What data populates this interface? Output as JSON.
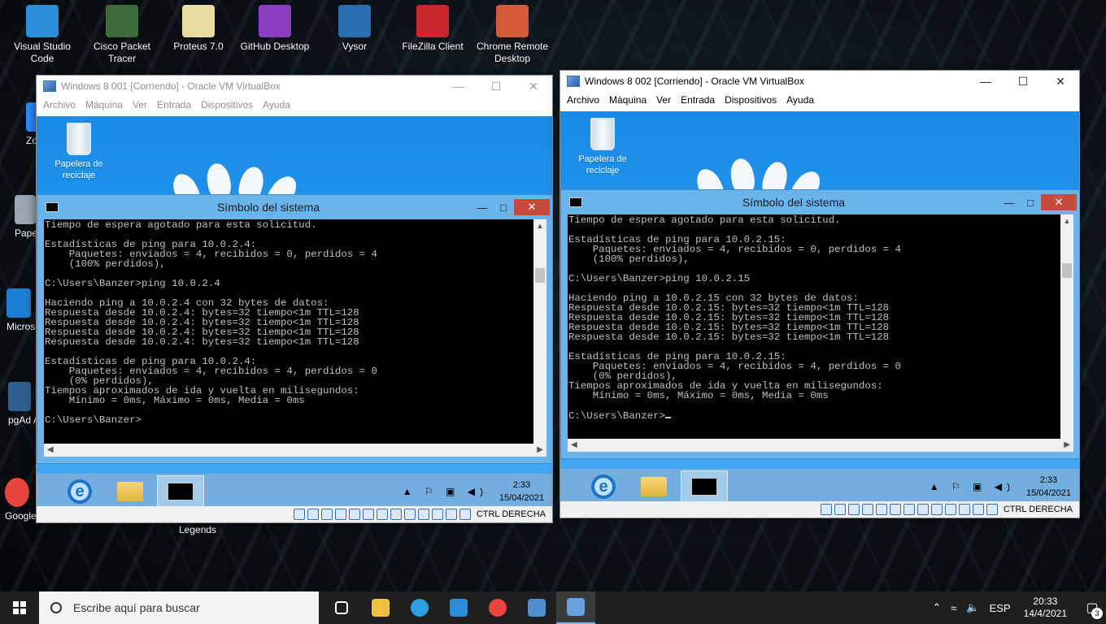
{
  "desktop": {
    "icons": [
      {
        "label": "Visual Studio Code",
        "icon": "vscode-icon",
        "color": "#2a8fd8"
      },
      {
        "label": "Cisco Packet Tracer",
        "icon": "cisco-icon",
        "color": "#3d6b3a"
      },
      {
        "label": "Proteus 7.0",
        "icon": "proteus-icon",
        "color": "#e8dca0"
      },
      {
        "label": "GitHub Desktop",
        "icon": "github-icon",
        "color": "#8a3fc0"
      },
      {
        "label": "Vysor",
        "icon": "vysor-icon",
        "color": "#2a6fb0"
      },
      {
        "label": "FileZilla Client",
        "icon": "filezilla-icon",
        "color": "#c8262c"
      },
      {
        "label": "Chrome Remote Desktop",
        "icon": "chrome-remote-icon",
        "color": "#d45a3a"
      }
    ],
    "left_clipped": [
      "Zo",
      "Pape rec",
      "Micros",
      "pgAd Acceso",
      "Google"
    ],
    "legends_label": "Legends"
  },
  "vm1": {
    "title": "Windows 8 001 [Corriendo] - Oracle VM VirtualBox",
    "menu": [
      "Archivo",
      "Máquina",
      "Ver",
      "Entrada",
      "Dispositivos",
      "Ayuda"
    ],
    "recycle_label": "Papelera de reciclaje",
    "cmd_title": "Símbolo del sistema",
    "cmd_lines": [
      "Tiempo de espera agotado para esta solicitud.",
      "",
      "Estadísticas de ping para 10.0.2.4:",
      "    Paquetes: enviados = 4, recibidos = 0, perdidos = 4",
      "    (100% perdidos),",
      "",
      "C:\\Users\\Banzer>ping 10.0.2.4",
      "",
      "Haciendo ping a 10.0.2.4 con 32 bytes de datos:",
      "Respuesta desde 10.0.2.4: bytes=32 tiempo<1m TTL=128",
      "Respuesta desde 10.0.2.4: bytes=32 tiempo<1m TTL=128",
      "Respuesta desde 10.0.2.4: bytes=32 tiempo<1m TTL=128",
      "Respuesta desde 10.0.2.4: bytes=32 tiempo<1m TTL=128",
      "",
      "Estadísticas de ping para 10.0.2.4:",
      "    Paquetes: enviados = 4, recibidos = 4, perdidos = 0",
      "    (0% perdidos),",
      "Tiempos aproximados de ida y vuelta en milisegundos:",
      "    Mínimo = 0ms, Máximo = 0ms, Media = 0ms",
      "",
      "C:\\Users\\Banzer>"
    ],
    "guest_time": "2:33",
    "guest_date": "15/04/2021",
    "host_key": "CTRL DERECHA"
  },
  "vm2": {
    "title": "Windows 8 002 [Corriendo] - Oracle VM VirtualBox",
    "menu": [
      "Archivo",
      "Máquina",
      "Ver",
      "Entrada",
      "Dispositivos",
      "Ayuda"
    ],
    "recycle_label": "Papelera de reciclaje",
    "cmd_title": "Símbolo del sistema",
    "cmd_lines": [
      "Tiempo de espera agotado para esta solicitud.",
      "",
      "Estadísticas de ping para 10.0.2.15:",
      "    Paquetes: enviados = 4, recibidos = 0, perdidos = 4",
      "    (100% perdidos),",
      "",
      "C:\\Users\\Banzer>ping 10.0.2.15",
      "",
      "Haciendo ping a 10.0.2.15 con 32 bytes de datos:",
      "Respuesta desde 10.0.2.15: bytes=32 tiempo<1m TTL=128",
      "Respuesta desde 10.0.2.15: bytes=32 tiempo<1m TTL=128",
      "Respuesta desde 10.0.2.15: bytes=32 tiempo<1m TTL=128",
      "Respuesta desde 10.0.2.15: bytes=32 tiempo<1m TTL=128",
      "",
      "Estadísticas de ping para 10.0.2.15:",
      "    Paquetes: enviados = 4, recibidos = 4, perdidos = 0",
      "    (0% perdidos),",
      "Tiempos aproximados de ida y vuelta en milisegundos:",
      "    Mínimo = 0ms, Máximo = 0ms, Media = 0ms",
      "",
      "C:\\Users\\Banzer>"
    ],
    "guest_time": "2:33",
    "guest_date": "15/04/2021",
    "host_key": "CTRL DERECHA"
  },
  "taskbar": {
    "search_placeholder": "Escribe aquí para buscar",
    "apps": [
      {
        "icon": "task-view-icon",
        "color": "#ffffff"
      },
      {
        "icon": "file-explorer-icon",
        "color": "#f0c040"
      },
      {
        "icon": "edge-icon",
        "color": "#2c9fe0"
      },
      {
        "icon": "vscode-icon",
        "color": "#2a8fd8"
      },
      {
        "icon": "chrome-icon",
        "color": "#e8453c"
      },
      {
        "icon": "virtualbox-icon",
        "color": "#4f8fd0"
      },
      {
        "icon": "virtualbox-vm-icon",
        "color": "#6aa0e0"
      }
    ],
    "lang": "ESP",
    "time": "20:33",
    "date": "14/4/2021",
    "notifications": "3"
  }
}
